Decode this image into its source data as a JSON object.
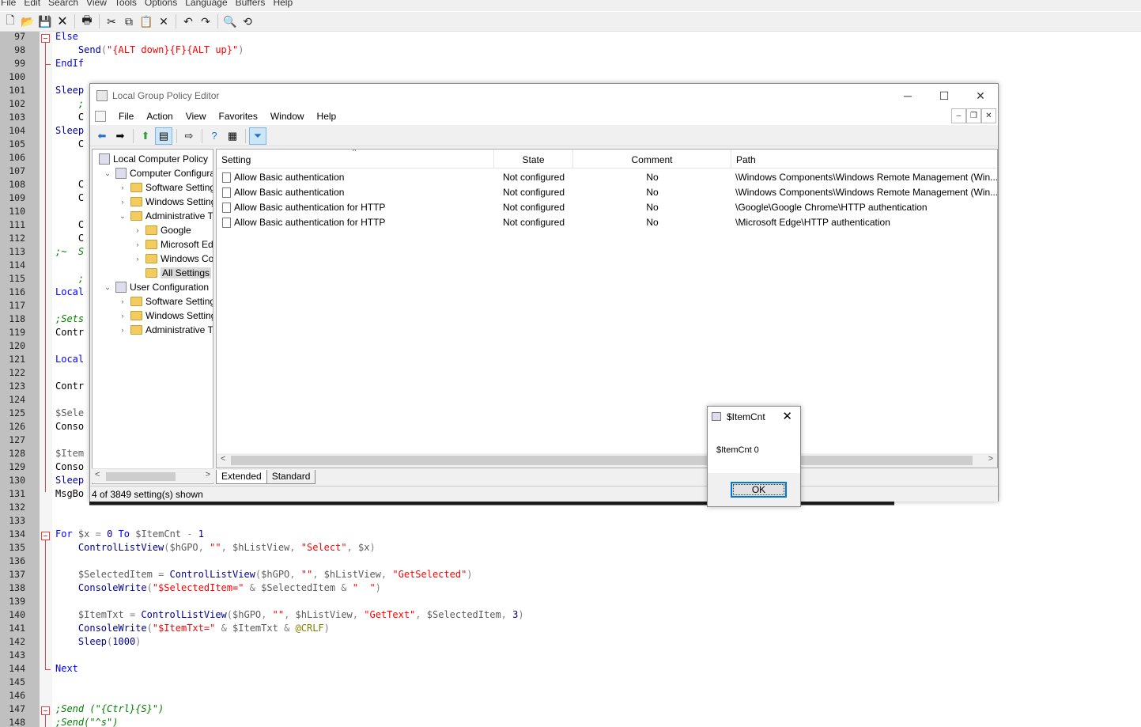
{
  "editor": {
    "menu": [
      "File",
      "Edit",
      "Search",
      "View",
      "Tools",
      "Options",
      "Language",
      "Buffers",
      "Help"
    ],
    "toolbar_icons": [
      "new-file-icon",
      "open-file-icon",
      "save-icon",
      "close-file-icon",
      "print-icon",
      "cut-icon",
      "copy-icon",
      "paste-icon",
      "delete-icon",
      "undo-icon",
      "redo-icon",
      "find-icon",
      "replace-icon"
    ],
    "lines": [
      {
        "n": "97",
        "text": "Else"
      },
      {
        "n": "98",
        "text": "    Send(\"{ALT down}{F}{ALT up}\")"
      },
      {
        "n": "99",
        "text": "EndIf"
      },
      {
        "n": "100",
        "text": ""
      },
      {
        "n": "101",
        "text": "Sleep"
      },
      {
        "n": "102",
        "text": "    ;"
      },
      {
        "n": "103",
        "text": "    C"
      },
      {
        "n": "104",
        "text": "Sleep"
      },
      {
        "n": "105",
        "text": "    C"
      },
      {
        "n": "106",
        "text": ""
      },
      {
        "n": "107",
        "text": ""
      },
      {
        "n": "108",
        "text": "    C"
      },
      {
        "n": "109",
        "text": "    C"
      },
      {
        "n": "110",
        "text": ""
      },
      {
        "n": "111",
        "text": "    C"
      },
      {
        "n": "112",
        "text": "    C"
      },
      {
        "n": "113",
        "text": ";~  S"
      },
      {
        "n": "114",
        "text": ""
      },
      {
        "n": "115",
        "text": "    ;"
      },
      {
        "n": "116",
        "text": "Local"
      },
      {
        "n": "117",
        "text": ""
      },
      {
        "n": "118",
        "text": ";Sets"
      },
      {
        "n": "119",
        "text": "Contr"
      },
      {
        "n": "120",
        "text": ""
      },
      {
        "n": "121",
        "text": "Local"
      },
      {
        "n": "122",
        "text": ""
      },
      {
        "n": "123",
        "text": "Contr"
      },
      {
        "n": "124",
        "text": ""
      },
      {
        "n": "125",
        "text": "$Sele"
      },
      {
        "n": "126",
        "text": "Conso"
      },
      {
        "n": "127",
        "text": ""
      },
      {
        "n": "128",
        "text": "$Item"
      },
      {
        "n": "129",
        "text": "Conso"
      },
      {
        "n": "130",
        "text": "Sleep"
      },
      {
        "n": "131",
        "text": "MsgBo"
      },
      {
        "n": "132",
        "text": ""
      },
      {
        "n": "133",
        "text": ""
      },
      {
        "n": "134",
        "text": "For $x = 0 To $ItemCnt - 1"
      },
      {
        "n": "135",
        "text": "    ControlListView($hGPO, \"\", $hListView, \"Select\", $x)"
      },
      {
        "n": "136",
        "text": ""
      },
      {
        "n": "137",
        "text": "    $SelectedItem = ControlListView($hGPO, \"\", $hListView, \"GetSelected\")"
      },
      {
        "n": "138",
        "text": "    ConsoleWrite(\"$SelectedItem=\" & $SelectedItem & \"  \")"
      },
      {
        "n": "139",
        "text": ""
      },
      {
        "n": "140",
        "text": "    $ItemTxt = ControlListView($hGPO, \"\", $hListView, \"GetText\", $SelectedItem, 3)"
      },
      {
        "n": "141",
        "text": "    ConsoleWrite(\"$ItemTxt=\" & $ItemTxt & @CRLF)"
      },
      {
        "n": "142",
        "text": "    Sleep(1000)"
      },
      {
        "n": "143",
        "text": ""
      },
      {
        "n": "144",
        "text": "Next"
      },
      {
        "n": "145",
        "text": ""
      },
      {
        "n": "146",
        "text": ""
      },
      {
        "n": "147",
        "text": ";Send (\"{Ctrl}{S}\")"
      },
      {
        "n": "148",
        "text": ";Send(\"^s\")"
      }
    ]
  },
  "gpo": {
    "title": "Local Group Policy Editor",
    "menu": [
      "File",
      "Action",
      "View",
      "Favorites",
      "Window",
      "Help"
    ],
    "tree": [
      {
        "label": "Local Computer Policy",
        "level": 0,
        "arrow": "",
        "icon": "policy"
      },
      {
        "label": "Computer Configura",
        "level": 1,
        "arrow": "v",
        "icon": "computer"
      },
      {
        "label": "Software Settings",
        "level": 2,
        "arrow": ">",
        "icon": "folder"
      },
      {
        "label": "Windows Setting",
        "level": 2,
        "arrow": ">",
        "icon": "folder"
      },
      {
        "label": "Administrative Te",
        "level": 2,
        "arrow": "v",
        "icon": "folder"
      },
      {
        "label": "Google",
        "level": 3,
        "arrow": ">",
        "icon": "folder"
      },
      {
        "label": "Microsoft Edg",
        "level": 3,
        "arrow": ">",
        "icon": "folder"
      },
      {
        "label": "Windows Cor",
        "level": 3,
        "arrow": ">",
        "icon": "folder"
      },
      {
        "label": "All Settings",
        "level": 3,
        "arrow": "",
        "icon": "folder",
        "selected": true
      },
      {
        "label": "User Configuration",
        "level": 1,
        "arrow": "v",
        "icon": "user"
      },
      {
        "label": "Software Settings",
        "level": 2,
        "arrow": ">",
        "icon": "folder"
      },
      {
        "label": "Windows Setting",
        "level": 2,
        "arrow": ">",
        "icon": "folder"
      },
      {
        "label": "Administrative Te",
        "level": 2,
        "arrow": ">",
        "icon": "folder"
      }
    ],
    "columns": [
      "Setting",
      "State",
      "Comment",
      "Path"
    ],
    "rows": [
      {
        "setting": "Allow Basic authentication",
        "state": "Not configured",
        "comment": "No",
        "path": "\\Windows Components\\Windows Remote Management (Win..."
      },
      {
        "setting": "Allow Basic authentication",
        "state": "Not configured",
        "comment": "No",
        "path": "\\Windows Components\\Windows Remote Management (Win..."
      },
      {
        "setting": "Allow Basic authentication for HTTP",
        "state": "Not configured",
        "comment": "No",
        "path": "\\Google\\Google Chrome\\HTTP authentication"
      },
      {
        "setting": "Allow Basic authentication for HTTP",
        "state": "Not configured",
        "comment": "No",
        "path": "\\Microsoft Edge\\HTTP authentication"
      }
    ],
    "tabs": [
      "Extended",
      "Standard"
    ],
    "status": "4 of 3849 setting(s) shown"
  },
  "msgbox": {
    "title": "$ItemCnt",
    "message": "$ItemCnt 0",
    "ok": "OK"
  },
  "colors": {
    "keyword": "#0000ff",
    "string": "#ff0000",
    "variable": "#5a5a5a",
    "function": "#000090",
    "comment": "#008000",
    "number": "#000090",
    "macro": "#808000"
  }
}
